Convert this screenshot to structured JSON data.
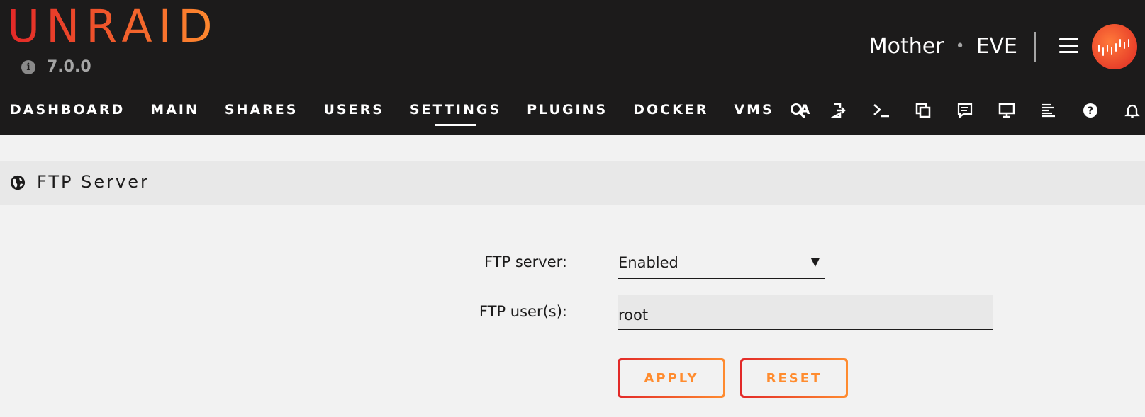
{
  "header": {
    "logo": "UNRAID",
    "version": "7.0.0",
    "server_name": "Mother",
    "separator": "•",
    "server_desc": "EVE"
  },
  "nav": {
    "items": [
      {
        "label": "DASHBOARD",
        "active": false
      },
      {
        "label": "MAIN",
        "active": false
      },
      {
        "label": "SHARES",
        "active": false
      },
      {
        "label": "USERS",
        "active": false
      },
      {
        "label": "SETTINGS",
        "active": true
      },
      {
        "label": "PLUGINS",
        "active": false
      },
      {
        "label": "DOCKER",
        "active": false
      },
      {
        "label": "VMS",
        "active": false
      },
      {
        "label": "A",
        "active": false
      }
    ],
    "icons": [
      "search-icon",
      "logout-icon",
      "terminal-icon",
      "copy-icon",
      "feedback-icon",
      "monitor-icon",
      "log-icon",
      "help-icon",
      "bell-icon"
    ]
  },
  "section": {
    "title": "FTP Server"
  },
  "form": {
    "ftp_server_label": "FTP server:",
    "ftp_server_value": "Enabled",
    "ftp_users_label": "FTP user(s):",
    "ftp_users_value": "root",
    "apply_label": "APPLY",
    "reset_label": "RESET"
  },
  "colors": {
    "accent_start": "#e22828",
    "accent_end": "#ff8c2f",
    "header_bg": "#1c1b1b"
  }
}
